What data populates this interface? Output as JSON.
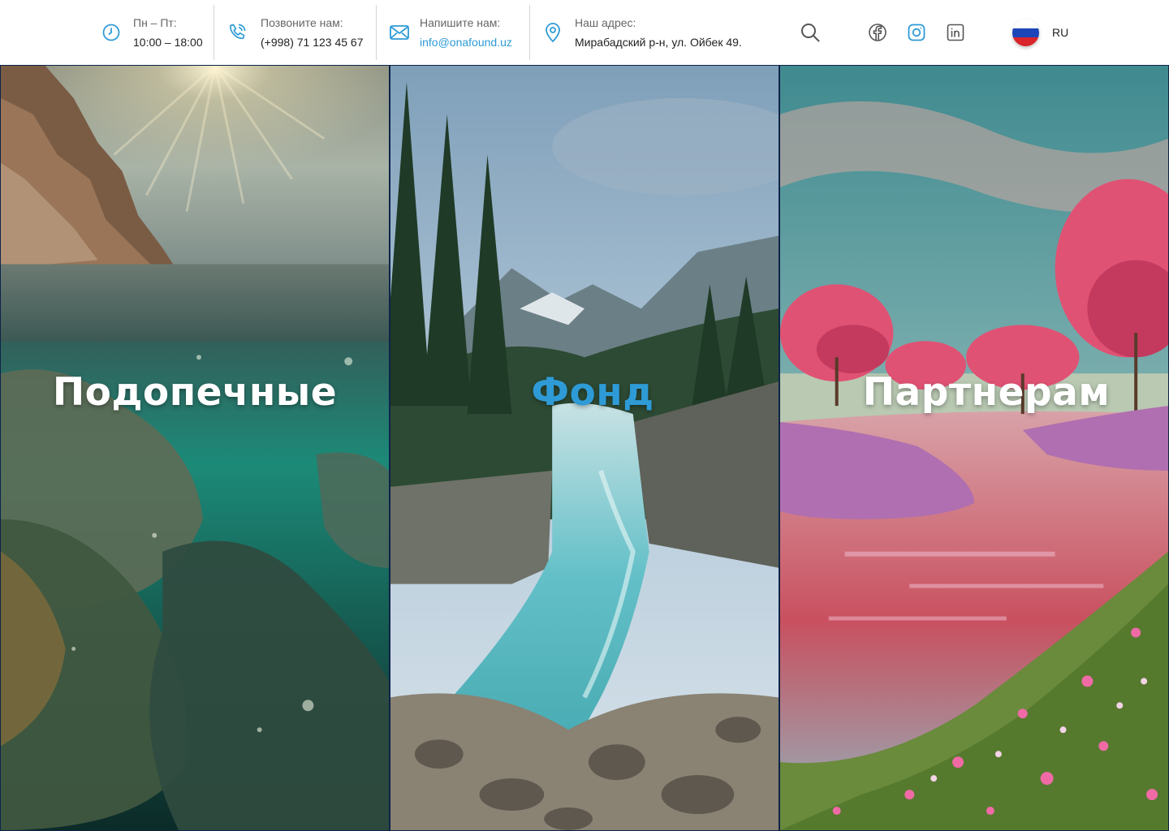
{
  "header": {
    "hours": {
      "label": "Пн – Пт:",
      "value": "10:00 – 18:00"
    },
    "phone": {
      "label": "Позвоните нам:",
      "value": "(+998) 71 123 45 67"
    },
    "email": {
      "label": "Напишите нам:",
      "value": "info@onafound.uz"
    },
    "address": {
      "label": "Наш адрес:",
      "value": "Мирабадский р-н, ул. Ойбек 49."
    },
    "icons": {
      "hours": "clock-icon",
      "phone": "phone-icon",
      "email": "mail-icon",
      "address": "location-pin-icon",
      "search": "search-icon",
      "facebook": "facebook-icon",
      "instagram": "instagram-icon",
      "linkedin": "linkedin-icon"
    },
    "language": {
      "code": "RU",
      "flag": "russia-flag"
    }
  },
  "panels": [
    {
      "title": "Подопечные",
      "active": false
    },
    {
      "title": "Фонд",
      "active": true
    },
    {
      "title": "Партнерам",
      "active": false
    }
  ],
  "colors": {
    "accent": "#2e9bd6",
    "instagram": "#2e9bd6",
    "icon_gray": "#555555",
    "panel_border": "#0d2448"
  }
}
